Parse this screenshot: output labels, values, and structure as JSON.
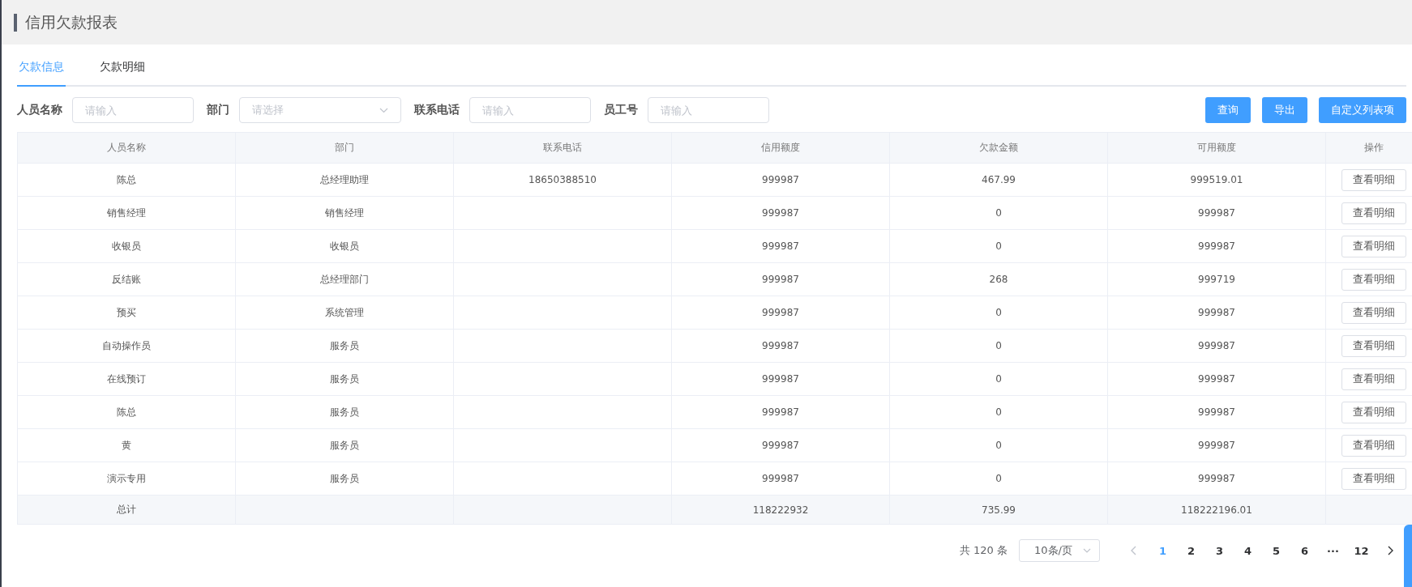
{
  "page_title": "信用欠款报表",
  "tabs": [
    {
      "label": "欠款信息",
      "selected": true
    },
    {
      "label": "欠款明细",
      "selected": false
    }
  ],
  "filters": [
    {
      "label": "人员名称",
      "kind": "input",
      "placeholder": "请输入"
    },
    {
      "label": "部门",
      "kind": "select",
      "placeholder": "请选择"
    },
    {
      "label": "联系电话",
      "kind": "input",
      "placeholder": "请输入"
    },
    {
      "label": "员工号",
      "kind": "input",
      "placeholder": "请输入"
    }
  ],
  "actions": [
    "查询",
    "导出",
    "自定义列表项"
  ],
  "table": {
    "columns": [
      "人员名称",
      "部门",
      "联系电话",
      "信用额度",
      "欠款金额",
      "可用额度",
      "操作"
    ],
    "rows": [
      {
        "cells": [
          "陈总",
          "总经理助理",
          "18650388510",
          "999987",
          "467.99",
          "999519.01"
        ],
        "action": "查看明细"
      },
      {
        "cells": [
          "销售经理",
          "销售经理",
          null,
          "999987",
          "0",
          "999987"
        ],
        "action": "查看明细"
      },
      {
        "cells": [
          "收银员",
          "收银员",
          null,
          "999987",
          "0",
          "999987"
        ],
        "action": "查看明细"
      },
      {
        "cells": [
          "反结账",
          "总经理部门",
          null,
          "999987",
          "268",
          "999719"
        ],
        "action": "查看明细"
      },
      {
        "cells": [
          "预买",
          "系统管理",
          null,
          "999987",
          "0",
          "999987"
        ],
        "action": "查看明细"
      },
      {
        "cells": [
          "自动操作员",
          "服务员",
          null,
          "999987",
          "0",
          "999987"
        ],
        "action": "查看明细"
      },
      {
        "cells": [
          "在线预订",
          "服务员",
          null,
          "999987",
          "0",
          "999987"
        ],
        "action": "查看明细"
      },
      {
        "cells": [
          "陈总",
          "服务员",
          null,
          "999987",
          "0",
          "999987"
        ],
        "action": "查看明细"
      },
      {
        "cells": [
          "黄",
          "服务员",
          null,
          "999987",
          "0",
          "999987"
        ],
        "action": "查看明细"
      },
      {
        "cells": [
          "演示专用",
          "服务员",
          null,
          "999987",
          "0",
          "999987"
        ],
        "action": "查看明细"
      }
    ],
    "total": {
      "label": "总计",
      "credit_limit": "118222932",
      "debt": "735.99",
      "available": "118222196.01"
    }
  },
  "pagination": {
    "total": "共 120 条",
    "page_size": "10条/页",
    "pages": [
      {
        "label": "1",
        "selected": true
      },
      {
        "label": "2",
        "selected": false
      },
      {
        "label": "3",
        "selected": false
      },
      {
        "label": "4",
        "selected": false
      },
      {
        "label": "5",
        "selected": false
      },
      {
        "label": "6",
        "selected": false
      },
      {
        "label": "···",
        "selected": false
      },
      {
        "label": "12",
        "selected": false
      }
    ]
  }
}
